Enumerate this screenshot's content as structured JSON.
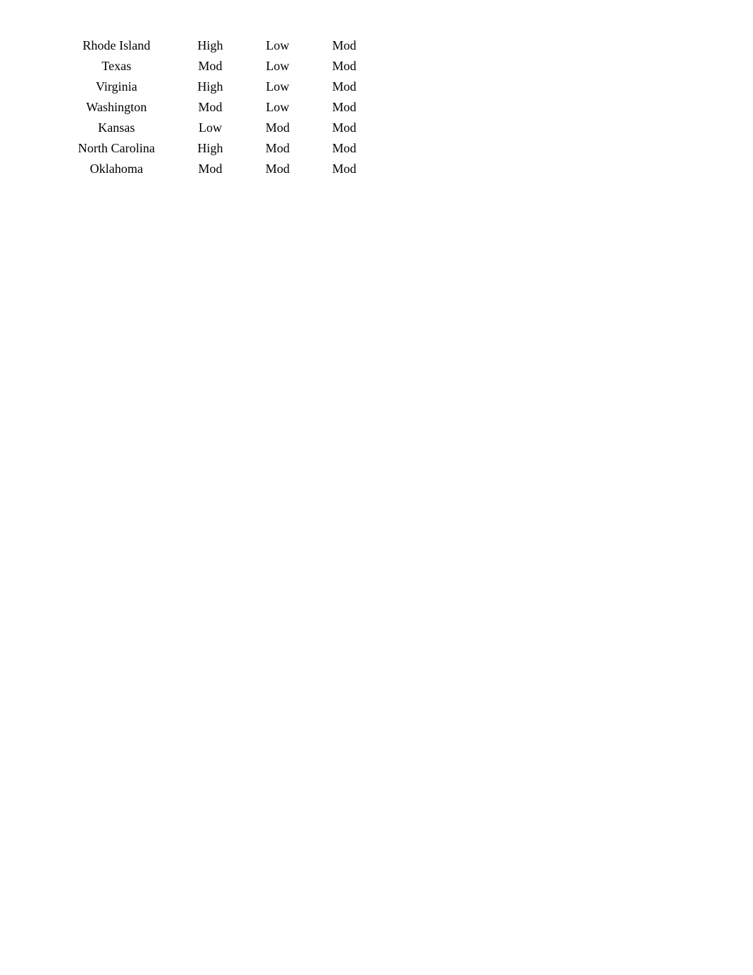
{
  "table": {
    "rows": [
      {
        "state": "Rhode Island",
        "col1": "High",
        "col2": "Low",
        "col3": "Mod"
      },
      {
        "state": "Texas",
        "col1": "Mod",
        "col2": "Low",
        "col3": "Mod"
      },
      {
        "state": "Virginia",
        "col1": "High",
        "col2": "Low",
        "col3": "Mod"
      },
      {
        "state": "Washington",
        "col1": "Mod",
        "col2": "Low",
        "col3": "Mod"
      },
      {
        "state": "Kansas",
        "col1": "Low",
        "col2": "Mod",
        "col3": "Mod"
      },
      {
        "state": "North Carolina",
        "col1": "High",
        "col2": "Mod",
        "col3": "Mod"
      },
      {
        "state": "Oklahoma",
        "col1": "Mod",
        "col2": "Mod",
        "col3": "Mod"
      }
    ]
  }
}
